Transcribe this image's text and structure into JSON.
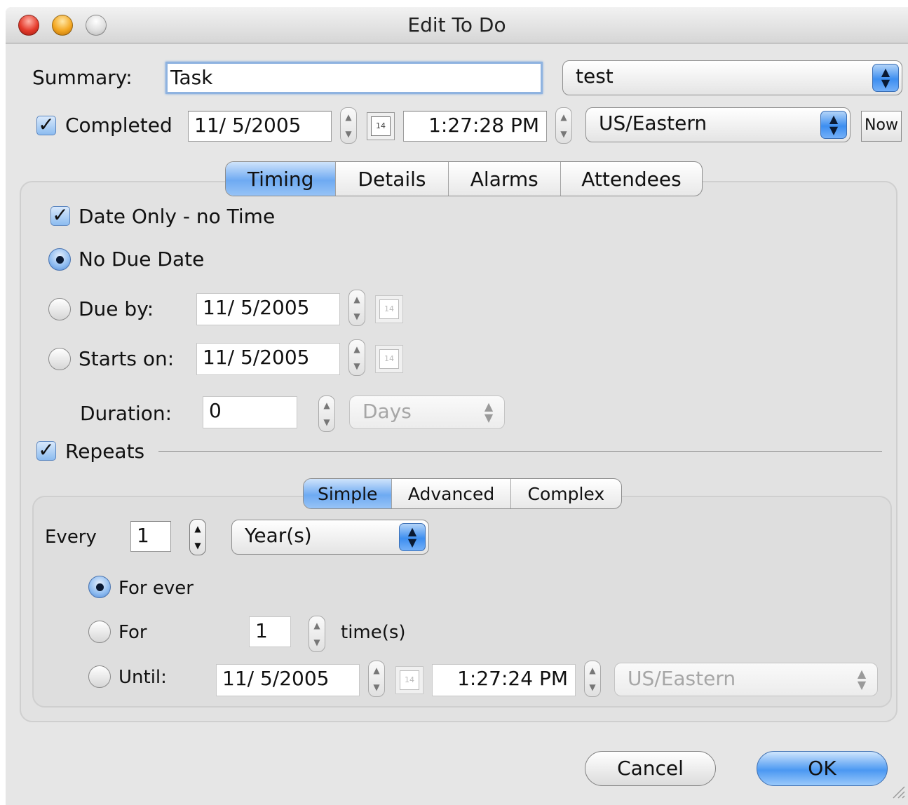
{
  "window": {
    "title": "Edit To Do"
  },
  "summary": {
    "label": "Summary:",
    "value": "Task",
    "calendar": "test"
  },
  "completed": {
    "label": "Completed",
    "checked": true,
    "date": "11/  5/2005",
    "time": "1:27:28 PM",
    "timezone": "US/Eastern",
    "now_label": "Now",
    "calendar_icon_text": "14"
  },
  "tabs": [
    "Timing",
    "Details",
    "Alarms",
    "Attendees"
  ],
  "timing": {
    "date_only_label": "Date Only - no Time",
    "no_due_date_label": "No Due Date",
    "due_by_label": "Due by:",
    "due_by_date": "11/  5/2005",
    "starts_on_label": "Starts on:",
    "starts_on_date": "11/  5/2005",
    "duration_label": "Duration:",
    "duration_value": "0",
    "duration_unit": "Days",
    "repeats_label": "Repeats"
  },
  "repeat_tabs": [
    "Simple",
    "Advanced",
    "Complex"
  ],
  "repeat": {
    "every_label": "Every",
    "every_value": "1",
    "every_unit": "Year(s)",
    "for_ever_label": "For ever",
    "for_label": "For",
    "for_value": "1",
    "times_label": "time(s)",
    "until_label": "Until:",
    "until_date": "11/  5/2005",
    "until_time": "1:27:24 PM",
    "until_timezone": "US/Eastern"
  },
  "buttons": {
    "cancel": "Cancel",
    "ok": "OK"
  }
}
